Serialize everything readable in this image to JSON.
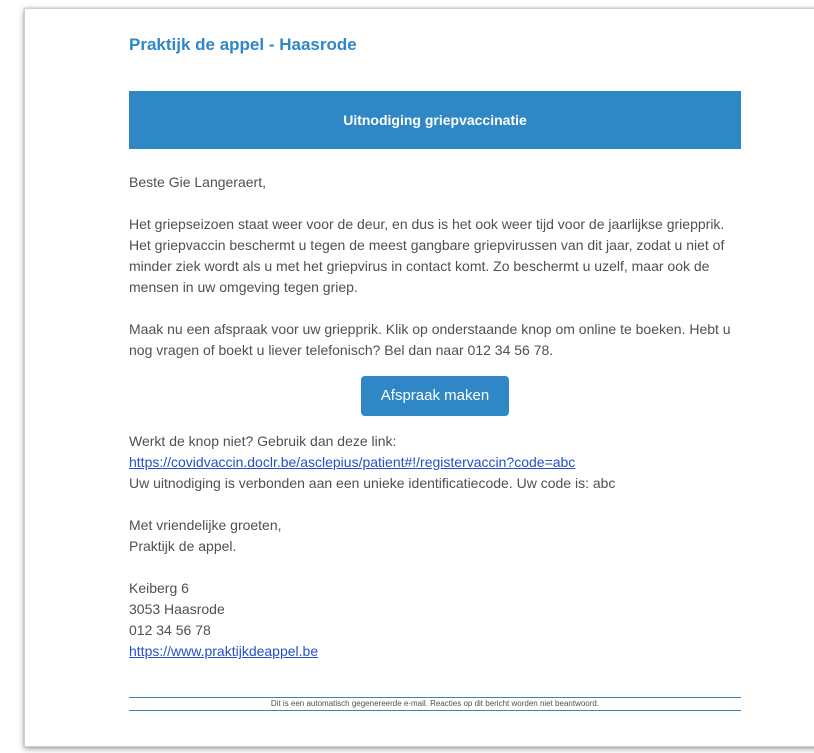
{
  "email": {
    "sender_title": "Praktijk de appel - Haasrode",
    "banner_title": "Uitnodiging griepvaccinatie",
    "greeting": "Beste Gie Langeraert,",
    "paragraph_1": "Het griepseizoen staat weer voor de deur, en dus is het ook weer tijd voor de jaarlijkse griepprik. Het griepvaccin beschermt u tegen de meest gangbare griepvirussen van dit jaar, zodat u niet of minder ziek wordt als u met het griepvirus in contact komt. Zo beschermt u uzelf, maar ook de mensen in uw omgeving tegen griep.",
    "paragraph_2": "Maak nu een afspraak voor uw griepprik. Klik op onderstaande knop om online te boeken. Hebt u nog vragen of boekt u liever telefonisch? Bel dan naar 012 34 56 78.",
    "button_label": "Afspraak maken",
    "fallback_prefix": "Werkt de knop niet? Gebruik dan deze link: ",
    "fallback_link": "https://covidvaccin.doclr.be/asclepius/patient#!/registervaccin?code=abc",
    "code_line": "Uw uitnodiging is verbonden aan een unieke identificatiecode. Uw code is: abc",
    "closing_1": "Met vriendelijke groeten,",
    "closing_2": "Praktijk de appel.",
    "address_street": "Keiberg 6",
    "address_city": "3053 Haasrode",
    "phone": "012 34 56 78",
    "website": "https://www.praktijkdeappel.be",
    "footer_note": "Dit is een automatisch gegenereerde e-mail. Reacties op dit bericht worden niet beantwoord."
  },
  "colors": {
    "accent": "#2f87c6",
    "link": "#2450c7",
    "body_text": "#505050"
  }
}
